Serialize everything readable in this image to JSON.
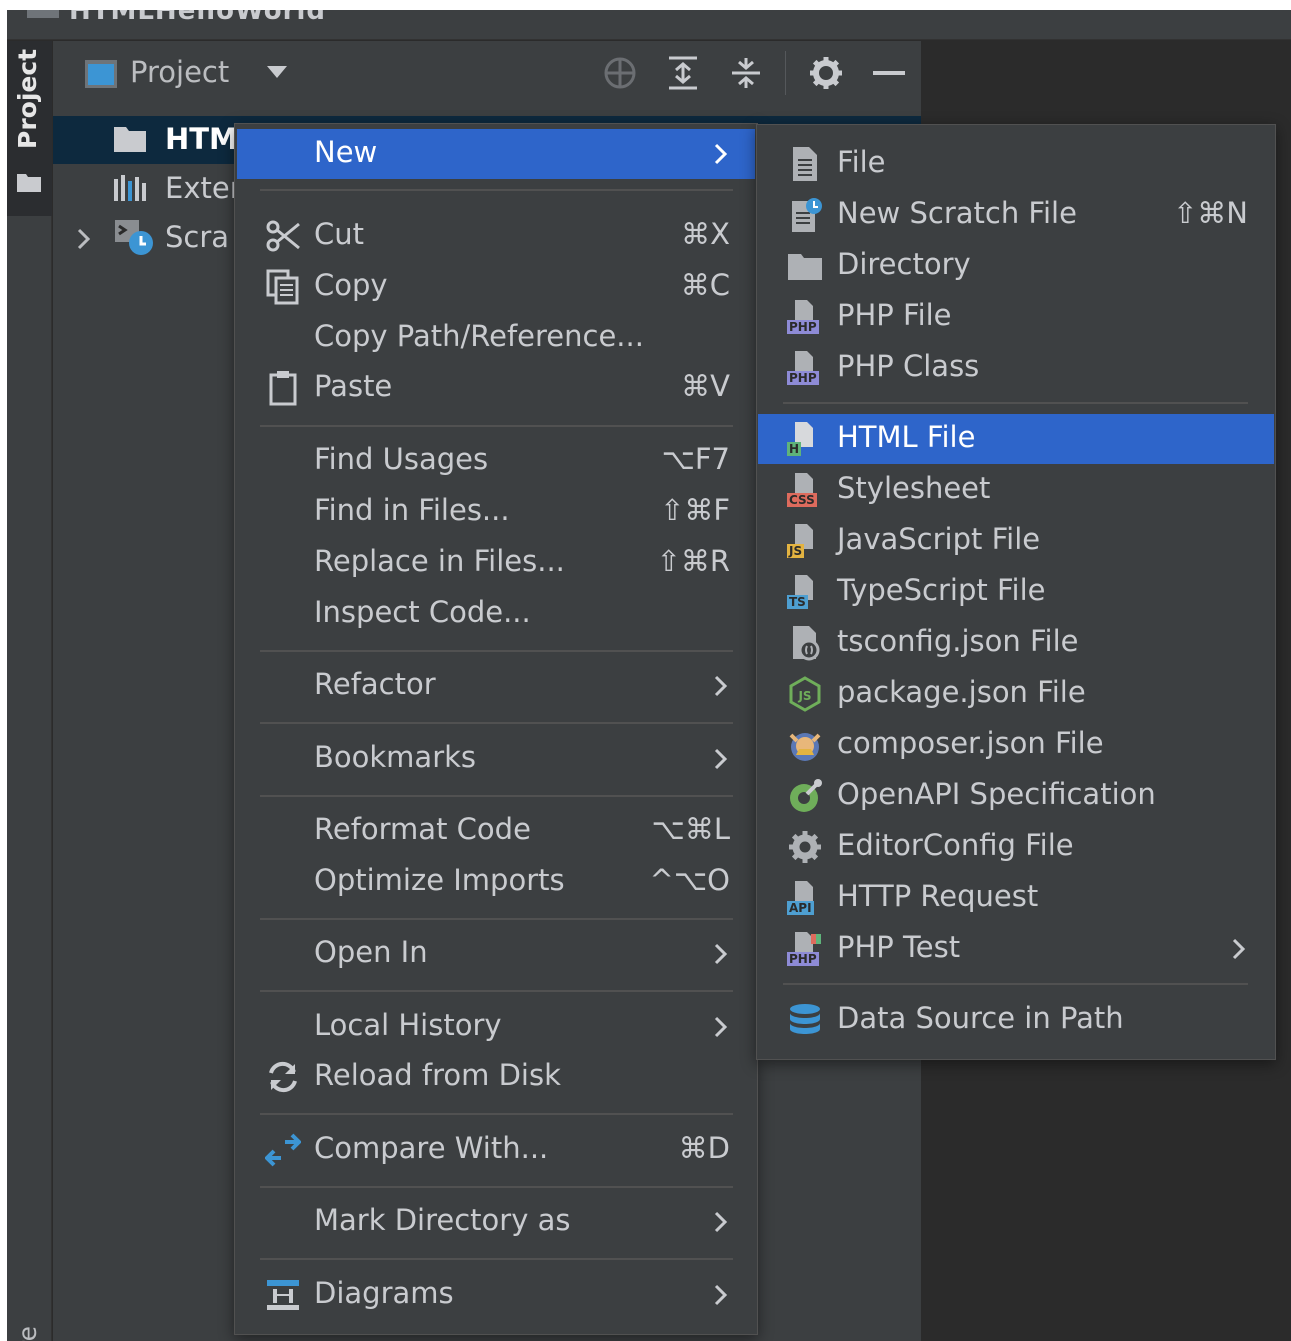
{
  "window": {
    "title": "HTMLHelloWorld"
  },
  "tool_strip": {
    "project_tab": "Project",
    "structure_tab": "ure"
  },
  "project_panel": {
    "title": "Project",
    "tree": [
      {
        "label": "HTM",
        "selected": true
      },
      {
        "label": "Exter"
      },
      {
        "label": "Scra"
      }
    ]
  },
  "context_menu": {
    "items": [
      {
        "label": "New",
        "shortcut": "",
        "submenu": true,
        "highlighted": true
      },
      {
        "label": "Cut",
        "shortcut": "⌘X",
        "icon": "scissors-icon"
      },
      {
        "label": "Copy",
        "shortcut": "⌘C",
        "icon": "copy-icon"
      },
      {
        "label": "Copy Path/Reference...",
        "shortcut": ""
      },
      {
        "label": "Paste",
        "shortcut": "⌘V",
        "icon": "clipboard-icon"
      },
      {
        "label": "Find Usages",
        "shortcut": "⌥F7"
      },
      {
        "label": "Find in Files...",
        "shortcut": "⇧⌘F"
      },
      {
        "label": "Replace in Files...",
        "shortcut": "⇧⌘R"
      },
      {
        "label": "Inspect Code...",
        "shortcut": ""
      },
      {
        "label": "Refactor",
        "submenu": true
      },
      {
        "label": "Bookmarks",
        "submenu": true
      },
      {
        "label": "Reformat Code",
        "shortcut": "⌥⌘L"
      },
      {
        "label": "Optimize Imports",
        "shortcut": "^⌥O"
      },
      {
        "label": "Open In",
        "submenu": true
      },
      {
        "label": "Local History",
        "submenu": true
      },
      {
        "label": "Reload from Disk",
        "icon": "reload-icon"
      },
      {
        "label": "Compare With...",
        "shortcut": "⌘D",
        "icon": "compare-icon"
      },
      {
        "label": "Mark Directory as",
        "submenu": true
      },
      {
        "label": "Diagrams",
        "submenu": true,
        "icon": "diagram-icon"
      }
    ]
  },
  "new_submenu": {
    "items": [
      {
        "label": "File",
        "icon": "file-icon"
      },
      {
        "label": "New Scratch File",
        "shortcut": "⇧⌘N",
        "icon": "scratch-file-icon"
      },
      {
        "label": "Directory",
        "icon": "folder-icon"
      },
      {
        "label": "PHP File",
        "icon": "php-file-icon",
        "badge": "PHP"
      },
      {
        "label": "PHP Class",
        "icon": "php-class-icon",
        "badge": "PHP"
      },
      {
        "label": "HTML File",
        "icon": "html-file-icon",
        "badge": "H",
        "highlighted": true
      },
      {
        "label": "Stylesheet",
        "icon": "css-file-icon",
        "badge": "CSS"
      },
      {
        "label": "JavaScript File",
        "icon": "js-file-icon",
        "badge": "JS"
      },
      {
        "label": "TypeScript File",
        "icon": "ts-file-icon",
        "badge": "TS"
      },
      {
        "label": "tsconfig.json File",
        "icon": "tsconfig-icon"
      },
      {
        "label": "package.json File",
        "icon": "nodejs-icon"
      },
      {
        "label": "composer.json File",
        "icon": "composer-icon"
      },
      {
        "label": "OpenAPI Specification",
        "icon": "openapi-icon"
      },
      {
        "label": "EditorConfig File",
        "icon": "gear-icon"
      },
      {
        "label": "HTTP Request",
        "icon": "api-file-icon",
        "badge": "API"
      },
      {
        "label": "PHP Test",
        "icon": "php-test-icon",
        "badge": "PHP",
        "submenu": true
      },
      {
        "label": "Data Source in Path",
        "icon": "database-icon"
      }
    ]
  },
  "colors": {
    "background": "#3c3f41",
    "editor": "#2b2b2b",
    "highlight": "#2e65ca",
    "text": "#c9cbcf",
    "badge_php": "#8e8bd6",
    "badge_html": "#5fb37a",
    "badge_css": "#de6b5d",
    "badge_js": "#e3b341",
    "badge_ts": "#4e9fd1",
    "accent_blue": "#3c95d4"
  }
}
